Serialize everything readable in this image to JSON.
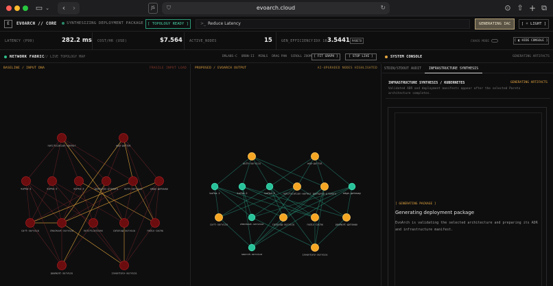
{
  "browser": {
    "url": "evoarch.cloud",
    "js_badge": "JS"
  },
  "topbar": {
    "logo": "E",
    "brand": "EVOARCH // CORE",
    "status": "SYNTHESIZING DEPLOYMENT PACKAGE",
    "topology_badge": "[ TOPOLOGY READY ]",
    "prompt": "Reduce Latency",
    "generate_button": "GENERATING IAC",
    "theme_button": "[ ☼ LIGHT ]"
  },
  "metrics": {
    "latency_label": "LATENCY (P99)",
    "latency_value": "282.2 ms",
    "cost_label": "COST/HR (USD)",
    "cost_value": "$7.564",
    "nodes_label": "ACTIVE_NODES",
    "nodes_value": "15",
    "gen_label": "GEN_EFFICIENCY",
    "gen_sub": "IDX 18",
    "gen_value": "3.5441",
    "pareto": "PARETO",
    "chaos_label": "CHAOS MODE",
    "hide_console": "[ ◧ HIDE CONSOLE ]"
  },
  "fabric": {
    "title": "NETWORK FABRIC",
    "subtitle": "LIVE TOPOLOGY MAP",
    "tools": [
      "DRLABS-C",
      "ORBN-II",
      "MINLS",
      "DRAG PAN",
      "SCROLL ZOOM"
    ],
    "fit_button": "[ FIT GRAPH ]",
    "stop_button": "[ STOP LIVE ]",
    "left_label": "BASELINE / INPUT DNA",
    "left_right_label": "FRAGILE INPUT LOAD",
    "mid_label": "PROPOSED / EVOARCH OUTPUT",
    "mid_right_label": "AI-UPGRADED NODES HIGHLIGHTED"
  },
  "colors": {
    "accent_green": "#2fc08a",
    "accent_amber": "#e6a640",
    "baseline_node": "#6b0d0f",
    "baseline_node_border": "#a01c1f",
    "proposed_green": "#28c29a",
    "proposed_amber": "#f5a623"
  },
  "baseline_graph": {
    "nodes": [
      {
        "label": "notification-worker",
        "hi": false
      },
      {
        "label": "web-portal",
        "hi": false
      },
      {
        "label": "kafka-1",
        "hi": false
      },
      {
        "label": "kafka-2",
        "hi": false
      },
      {
        "label": "kafka-3",
        "hi": false
      },
      {
        "label": "postgres-primary",
        "hi": false
      },
      {
        "label": "auth-service",
        "hi": false
      },
      {
        "label": "edge-gateway",
        "hi": false
      },
      {
        "label": "cart-service",
        "hi": false
      },
      {
        "label": "checkout-service",
        "hi": false
      },
      {
        "label": "notifications",
        "hi": false
      },
      {
        "label": "catalog-service",
        "hi": false
      },
      {
        "label": "redis-cache",
        "hi": false
      },
      {
        "label": "payment-service",
        "hi": false
      },
      {
        "label": "inventory-service",
        "hi": false
      }
    ]
  },
  "proposed_graph": {
    "nodes": [
      {
        "label": "auth-service",
        "hi": true
      },
      {
        "label": "web-portal",
        "hi": true
      },
      {
        "label": "kafka-1",
        "hi": false
      },
      {
        "label": "kafka-2",
        "hi": false
      },
      {
        "label": "kafka-3",
        "hi": false
      },
      {
        "label": "notification-worker",
        "hi": true
      },
      {
        "label": "postgres-primary",
        "hi": true
      },
      {
        "label": "edge-gateway",
        "hi": false
      },
      {
        "label": "cart-service",
        "hi": true
      },
      {
        "label": "checkout-service",
        "hi": false
      },
      {
        "label": "catalog-service",
        "hi": true
      },
      {
        "label": "redis-cache",
        "hi": true
      },
      {
        "label": "payment-gateway",
        "hi": true
      },
      {
        "label": "search-service",
        "hi": false
      },
      {
        "label": "inventory-service",
        "hi": true
      }
    ]
  },
  "console": {
    "title": "SYSTEM CONSOLE",
    "generating": "GENERATING ARTIFACTS",
    "tab_audit": "STDIN/STDOUT AUDIT",
    "tab_synth": "INFRASTRUCTURE SYNTHESIS",
    "box_title": "INFRASTRUCTURE SYNTHESIS / KUBERNETES",
    "box_tag": "GENERATING ARTIFACTS",
    "box_desc": "Validated ADR and deployment manifests appear after the selected Pareto architecture completes.",
    "package_tag": "[ GENERATING PACKAGE ]",
    "package_title": "Generating deployment package",
    "package_desc": "EvoArch is validating the selected architecture and preparing its ADR and infrastructure manifest."
  }
}
